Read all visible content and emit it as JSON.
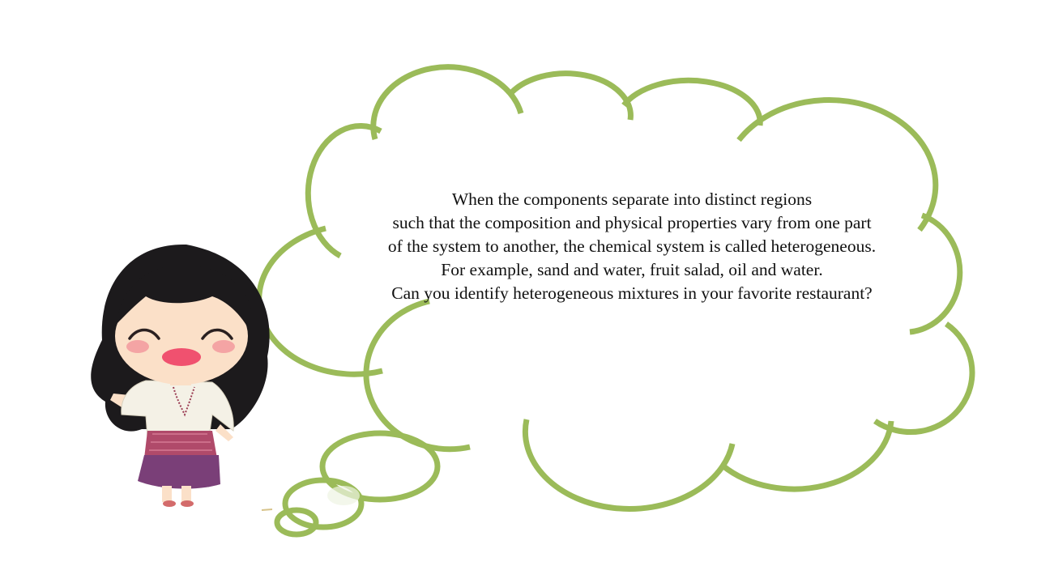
{
  "bubble": {
    "lines": [
      "When the components separate into distinct regions",
      "such that the composition and physical properties vary from one part",
      "of the system to another, the chemical system is called heterogeneous.",
      "For example, sand and water, fruit salad, oil and water.",
      "Can you identify heterogeneous mixtures in your favorite restaurant?"
    ]
  },
  "colors": {
    "bubble_outline": "#9bbb59",
    "background": "#ffffff",
    "text": "#111111",
    "hair": "#1c1a1c",
    "skin": "#fbe0c8",
    "blouse": "#f4f1e6",
    "skirt_top": "#b04a6a",
    "skirt_bottom": "#7a3f78",
    "cheeks": "#f4a4a4",
    "mouth": "#f0516f"
  },
  "icons": {
    "character": "cartoon-girl-illustration",
    "thought_bubble": "cloud-thought-bubble"
  }
}
